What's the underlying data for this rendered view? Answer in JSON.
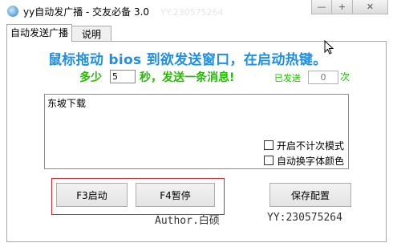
{
  "window": {
    "title": "yy自动发广播 - 交友必备  3.0",
    "background_ghost_text": "YY:230575264",
    "controls": {
      "minimize": "—",
      "maximize": "+",
      "close": "✕"
    }
  },
  "tabs": [
    {
      "label": "自动发送广播",
      "active": true
    },
    {
      "label": "说明",
      "active": false
    }
  ],
  "main": {
    "headline": "鼠标拖动 bios 到欲发送窗口，在启动热键。",
    "interval_prefix": "多少",
    "interval_value": "5",
    "interval_suffix": "秒，发送一条消息!",
    "sent_label": "已发送",
    "sent_count": "0",
    "sent_unit": "次",
    "message_text": "东坡下载",
    "options": {
      "no_count_mode_label": "开启不计次模式",
      "auto_font_color_label": "自动换字体颜色"
    },
    "buttons": {
      "start": "F3启动",
      "pause": "F4暂停",
      "save": "保存配置"
    },
    "author": "Author.白硕",
    "contact": "YY:230575264"
  },
  "colors": {
    "headline": "#1e8ee8",
    "green_text": "#22bb00",
    "highlight_box": "#e0242c"
  },
  "icons": {
    "app": "globe-icon",
    "pointer": "mouse-cursor-icon"
  }
}
